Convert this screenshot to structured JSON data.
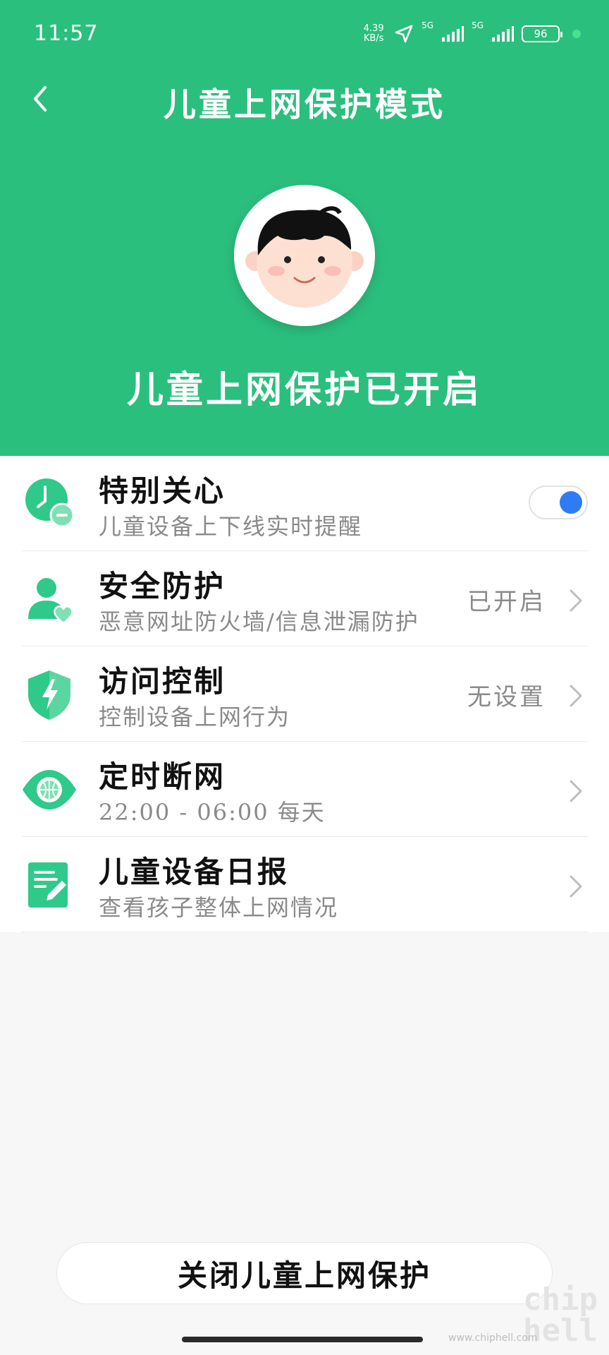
{
  "status_bar": {
    "time": "11:57",
    "net_speed_value": "4.39",
    "net_speed_unit": "KB/s",
    "signal1_label": "5G",
    "signal2_label": "5G",
    "battery": "96"
  },
  "nav": {
    "title": "儿童上网保护模式"
  },
  "hero": {
    "status": "儿童上网保护已开启"
  },
  "settings": [
    {
      "title": "特别关心",
      "subtitle": "儿童设备上下线实时提醒",
      "control": "toggle",
      "toggle_on": true,
      "icon": "clock-minus-icon"
    },
    {
      "title": "安全防护",
      "subtitle": "恶意网址防火墙/信息泄漏防护",
      "value": "已开启",
      "icon": "person-heart-icon"
    },
    {
      "title": "访问控制",
      "subtitle": "控制设备上网行为",
      "value": "无设置",
      "icon": "shield-bolt-icon"
    },
    {
      "title": "定时断网",
      "subtitle": "22:00 - 06:00 每天",
      "value": "",
      "icon": "eye-globe-icon"
    },
    {
      "title": "儿童设备日报",
      "subtitle": "查看孩子整体上网情况",
      "value": "",
      "icon": "report-edit-icon"
    }
  ],
  "actions": {
    "close_label": "关闭儿童上网保护"
  },
  "watermark": {
    "logo": "chip hell",
    "url": "www.chiphell.com"
  },
  "colors": {
    "header_green": "#2bbf7e",
    "icon_green": "#2fc98a",
    "toggle_blue": "#2f7cf2"
  }
}
